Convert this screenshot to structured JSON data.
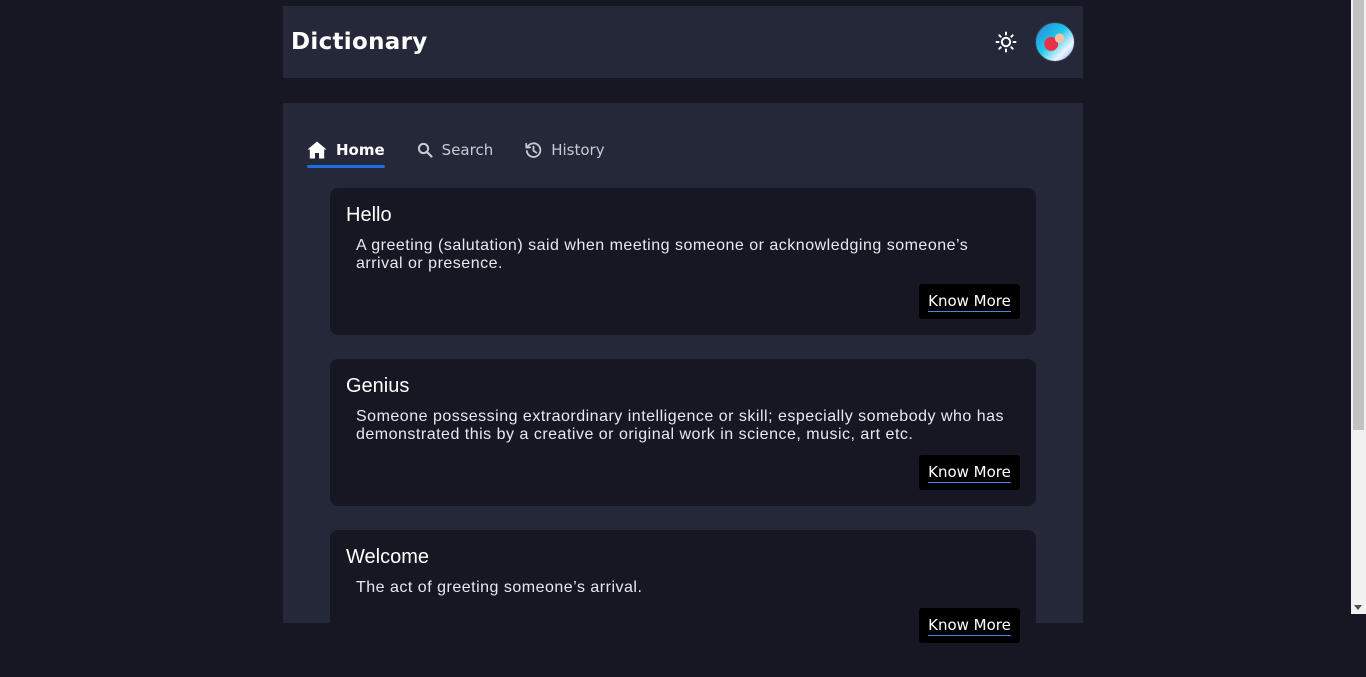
{
  "app": {
    "title": "Dictionary"
  },
  "header": {
    "theme_icon": "sun-icon",
    "avatar": "user-avatar"
  },
  "tabs": [
    {
      "label": "Home",
      "icon": "home-icon",
      "active": true
    },
    {
      "label": "Search",
      "icon": "search-icon",
      "active": false
    },
    {
      "label": "History",
      "icon": "history-icon",
      "active": false
    }
  ],
  "words": [
    {
      "word": "Hello",
      "definition": "A greeting (salutation) said when meeting someone or acknowledging someone’s arrival or presence.",
      "button": "Know More"
    },
    {
      "word": "Genius",
      "definition": "Someone possessing extraordinary intelligence or skill; especially somebody who has demonstrated this by a creative or original work in science, music, art etc.",
      "button": "Know More"
    },
    {
      "word": "Welcome",
      "definition": "The act of greeting someone’s arrival.",
      "button": "Know More"
    }
  ],
  "colors": {
    "background": "#161722",
    "surface": "#252839",
    "accent": "#1d6fe0",
    "button": "#000000"
  }
}
